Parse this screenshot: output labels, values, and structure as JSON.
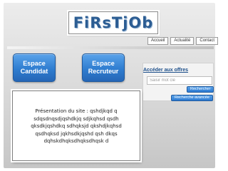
{
  "logo": {
    "text": "FiRsTjOb"
  },
  "nav": {
    "items": [
      {
        "label": "Accueil"
      },
      {
        "label": "Actualité"
      },
      {
        "label": "Contact"
      }
    ]
  },
  "spaces": {
    "candidat": {
      "line1": "Espace",
      "line2": "Candidat"
    },
    "recruteur": {
      "line1": "Espace",
      "line2": "Recruteur"
    }
  },
  "offers": {
    "title": "Accéder aux offres",
    "search_placeholder": "Saisir mot clé",
    "search_value": "",
    "search_button": "Rechercher",
    "advanced_button": "Recherche avancée"
  },
  "presentation": {
    "text": "Présentation du site : qshdjkqd q sdqsdnqsdjqshdkjq sdjkqhsd qsdh qksdkjqshdkq sdhqksjd qkshdjkqhsd qsdhqksd jqkhsdkjqshd qsh dkqs dqhskdhqksdhqksdhqsk d"
  },
  "colors": {
    "accent_blue": "#2f7dd0",
    "logo_blue": "#2c5d93",
    "link_blue": "#1d4f8a"
  }
}
